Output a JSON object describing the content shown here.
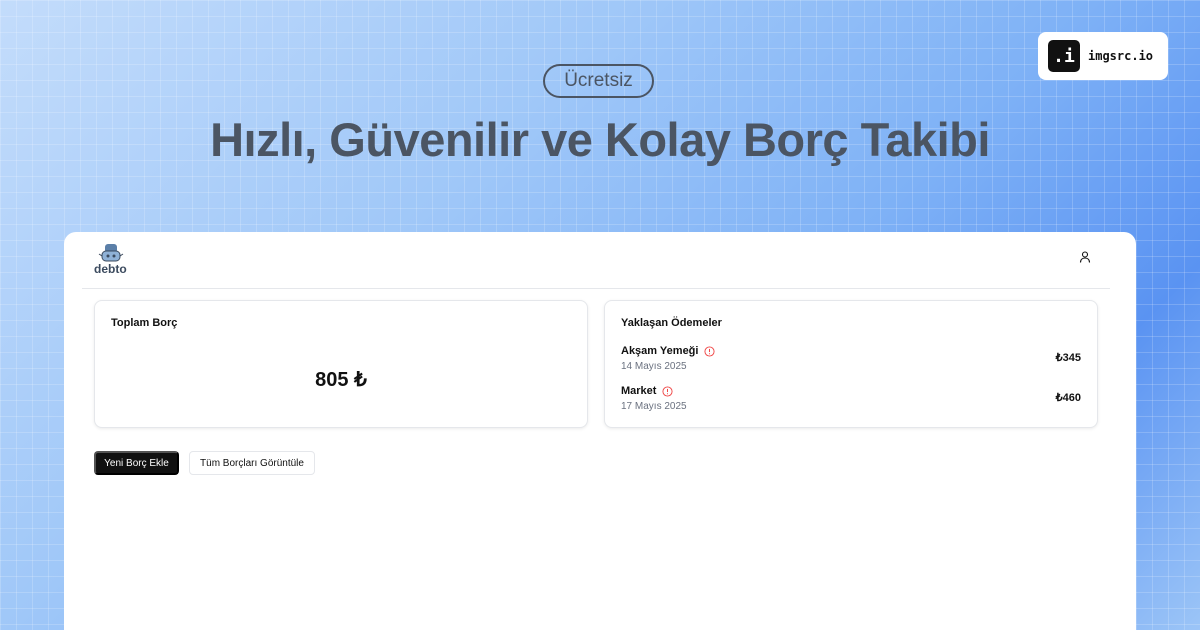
{
  "hero": {
    "badge": "Ücretsiz",
    "headline": "Hızlı, Güvenilir ve Kolay Borç Takibi"
  },
  "brand": {
    "icon_glyph": ".i",
    "name": "imgsrc.io"
  },
  "app": {
    "logo_text": "debto",
    "total_card": {
      "title": "Toplam Borç",
      "amount": "805 ₺"
    },
    "upcoming_card": {
      "title": "Yaklaşan Ödemeler",
      "payments": [
        {
          "name": "Akşam Yemeği",
          "date": "14 Mayıs 2025",
          "amount": "₺345"
        },
        {
          "name": "Market",
          "date": "17 Mayıs 2025",
          "amount": "₺460"
        }
      ]
    },
    "buttons": {
      "add_debt": "Yeni Borç Ekle",
      "view_all": "Tüm Borçları Görüntüle"
    }
  },
  "colors": {
    "alert": "#ef4444",
    "primary_button": "#111111"
  },
  "icons": [
    "imgsrc-logo-icon",
    "debto-logo-icon",
    "user-icon",
    "alert-circle-icon"
  ]
}
